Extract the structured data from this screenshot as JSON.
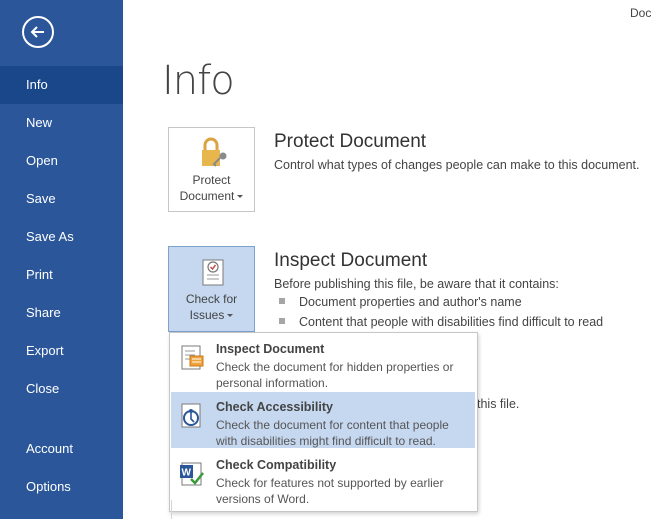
{
  "window": {
    "doc_title": "Doc"
  },
  "sidebar": {
    "items": [
      {
        "label": "Info"
      },
      {
        "label": "New"
      },
      {
        "label": "Open"
      },
      {
        "label": "Save"
      },
      {
        "label": "Save As"
      },
      {
        "label": "Print"
      },
      {
        "label": "Share"
      },
      {
        "label": "Export"
      },
      {
        "label": "Close"
      },
      {
        "label": "Account"
      },
      {
        "label": "Options"
      }
    ],
    "active": "Info"
  },
  "main": {
    "title": "Info",
    "protect": {
      "button_line1": "Protect",
      "button_line2": "Document",
      "heading": "Protect Document",
      "description": "Control what types of changes people can make to this document."
    },
    "inspect": {
      "button_line1": "Check for",
      "button_line2": "Issues",
      "heading": "Inspect Document",
      "description": "Before publishing this file, be aware that it contains:",
      "bullets": [
        "Document properties and author's name",
        "Content that people with disabilities find difficult to read"
      ],
      "partial_text": "this file."
    },
    "menu": {
      "items": [
        {
          "title": "Inspect Document",
          "description": "Check the document for hidden properties or personal information."
        },
        {
          "title": "Check Accessibility",
          "description": "Check the document for content that people with disabilities might find difficult to read."
        },
        {
          "title": "Check Compatibility",
          "description": "Check for features not supported by earlier versions of Word."
        }
      ],
      "highlighted_index": 1
    }
  },
  "colors": {
    "sidebar": "#2b579a",
    "sidebar_active": "#19478a",
    "highlight": "#c5d8f0"
  }
}
